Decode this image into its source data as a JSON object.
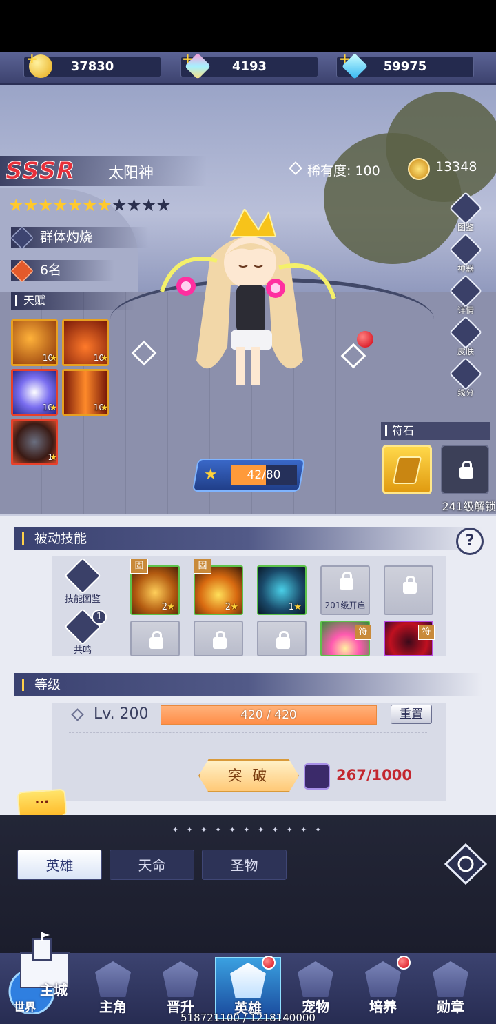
{
  "currencies": [
    {
      "icon": "gold-coin-icon",
      "value": "37830"
    },
    {
      "icon": "rainbow-crystal-icon",
      "value": "4193"
    },
    {
      "icon": "blue-diamond-icon",
      "value": "59975"
    }
  ],
  "hero": {
    "grade": "SSSR",
    "name": "太阳神",
    "rarity": "稀有度:  100",
    "power": "13348",
    "stars_filled": 7,
    "stars_total": 11,
    "class_tag": "群体灼烧",
    "rank_tag": "6名"
  },
  "talents": {
    "header": "天赋",
    "items": [
      {
        "level": "10"
      },
      {
        "level": "10"
      },
      {
        "level": "10"
      },
      {
        "level": "10"
      },
      {
        "level": "1"
      }
    ]
  },
  "side_buttons": [
    "图鉴",
    "神器",
    "详情",
    "皮肤",
    "缘分"
  ],
  "xp": {
    "text": "42/80",
    "progress": 0.525
  },
  "rune": {
    "header": "符石",
    "lock_text": "241级解锁"
  },
  "passive": {
    "header": "被动技能",
    "help": "?",
    "codex_label": "技能图鉴",
    "resonance_label": "共鸣",
    "resonance_badge": "1",
    "fixed_badge": "固",
    "rune_badge": "符",
    "skills": [
      {
        "level": "2"
      },
      {
        "level": "2"
      },
      {
        "level": "1"
      }
    ],
    "locked_caption": "201级开启"
  },
  "level": {
    "header": "等级",
    "text": "Lv. 200",
    "bar_text": "420 / 420",
    "progress": 1.0,
    "reset": "重置",
    "break_button": "突 破",
    "break_cost": "267/1000"
  },
  "chat": {
    "label": "···"
  },
  "divider": "✦ ✦ ✦ ✦ ✦ ✦ ✦ ✦ ✦ ✦ ✦",
  "tabs": [
    {
      "label": "英雄",
      "selected": true
    },
    {
      "label": "天命",
      "selected": false
    },
    {
      "label": "圣物",
      "selected": false
    }
  ],
  "nav": {
    "main_city": "主城",
    "world": "世界",
    "items": [
      {
        "label": "主角",
        "icon": "protagonist-icon"
      },
      {
        "label": "晋升",
        "icon": "promotion-icon"
      },
      {
        "label": "英雄",
        "icon": "hero-helmet-icon",
        "selected": true,
        "dot": true
      },
      {
        "label": "宠物",
        "icon": "pet-icon"
      },
      {
        "label": "培养",
        "icon": "cultivate-icon",
        "dot": true
      },
      {
        "label": "勋章",
        "icon": "medal-icon"
      }
    ]
  },
  "exp_total": "518721100 / 1218140000",
  "colors": {
    "accent_red": "#e8303a",
    "gold": "#ffc92c",
    "navy": "#3a4170",
    "orange_bar": "#ff8d48"
  }
}
